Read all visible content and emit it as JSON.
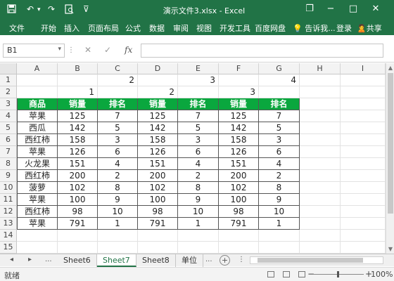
{
  "titlebar": {
    "title": "演示文件3.xlsx - Excel",
    "save_icon": "save-icon",
    "undo": "↶",
    "undo_dd": "▾",
    "redo": "↷",
    "print_preview": "🔍",
    "customize": "⊽",
    "restore": "❐",
    "minimize": "−",
    "maximize": "□",
    "close": "✕"
  },
  "menubar": {
    "items": [
      "文件",
      "开始",
      "插入",
      "页面布局",
      "公式",
      "数据",
      "审阅",
      "视图",
      "开发工具",
      "百度网盘"
    ],
    "tellme": "💡 告诉我...",
    "login": "登录",
    "share": "🙎共享"
  },
  "formulabar": {
    "cell_ref": "B1",
    "dropdown": "▾",
    "dots": "⋮",
    "cancel": "✕",
    "enter": "✓",
    "fx": "fx",
    "value": ""
  },
  "grid": {
    "columns": [
      "A",
      "B",
      "C",
      "D",
      "E",
      "F",
      "G",
      "H",
      "I"
    ],
    "rows": [
      "1",
      "2",
      "3",
      "4",
      "5",
      "6",
      "7",
      "8",
      "9",
      "10",
      "11",
      "12",
      "13",
      "14",
      "15"
    ],
    "row1": [
      "2",
      "3",
      "4"
    ],
    "row2": [
      "1",
      "2",
      "3"
    ],
    "header": [
      "商品",
      "销量",
      "排名",
      "销量",
      "排名",
      "销量",
      "排名"
    ],
    "data": [
      [
        "苹果",
        "125",
        "7",
        "125",
        "7",
        "125",
        "7"
      ],
      [
        "西瓜",
        "142",
        "5",
        "142",
        "5",
        "142",
        "5"
      ],
      [
        "西红柿",
        "158",
        "3",
        "158",
        "3",
        "158",
        "3"
      ],
      [
        "苹果",
        "126",
        "6",
        "126",
        "6",
        "126",
        "6"
      ],
      [
        "火龙果",
        "151",
        "4",
        "151",
        "4",
        "151",
        "4"
      ],
      [
        "西红柿",
        "200",
        "2",
        "200",
        "2",
        "200",
        "2"
      ],
      [
        "菠萝",
        "102",
        "8",
        "102",
        "8",
        "102",
        "8"
      ],
      [
        "苹果",
        "100",
        "9",
        "100",
        "9",
        "100",
        "9"
      ],
      [
        "西红柿",
        "98",
        "10",
        "98",
        "10",
        "98",
        "10"
      ],
      [
        "苹果",
        "791",
        "1",
        "791",
        "1",
        "791",
        "1"
      ]
    ]
  },
  "sheets": {
    "prev": "◂",
    "next": "▸",
    "more_left": "...",
    "tabs": [
      "Sheet6",
      "Sheet7",
      "Sheet8",
      "单位"
    ],
    "active": "Sheet7",
    "more_right": "...",
    "add": "+"
  },
  "status": {
    "text": "就绪",
    "zoom_out": "−",
    "zoom_in": "+",
    "zoom_level": "100%"
  },
  "colors": {
    "excel_green": "#217346",
    "header_fill": "#0aa73e"
  }
}
